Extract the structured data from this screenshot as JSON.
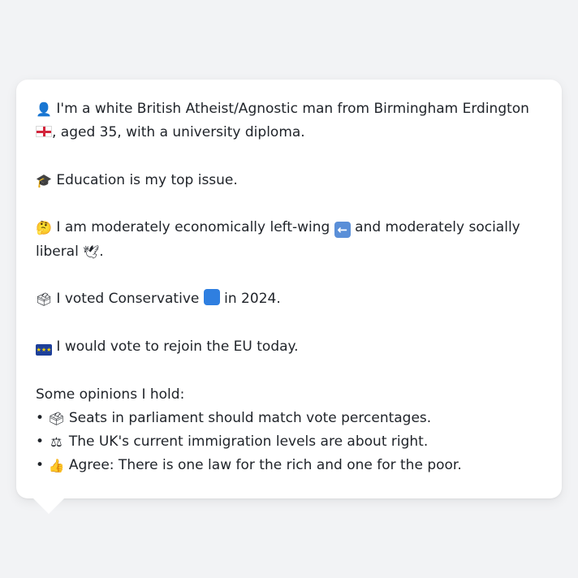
{
  "profile": {
    "intro": {
      "icon": "bust-in-silhouette-icon",
      "text_before_flag": "I'm a white British Atheist/Agnostic man from Birmingham Erdington",
      "flag": "england-flag-icon",
      "text_after_flag": ", aged 35, with a university diploma."
    },
    "top_issue": {
      "icon": "graduation-cap-icon",
      "text": "Education is my top issue."
    },
    "ideology": {
      "icon": "thinking-face-icon",
      "text_part1": "I am moderately economically left-wing",
      "left_icon": "left-arrow-icon",
      "text_part2": "and moderately socially liberal",
      "liberal_icon": "dove-icon",
      "text_end": "."
    },
    "vote_2024": {
      "icon": "ballot-box-icon",
      "text_before": "I voted Conservative",
      "party_icon": "blue-square-icon",
      "text_after": "in 2024."
    },
    "eu": {
      "icon": "eu-flag-icon",
      "text": "I would vote to rejoin the EU today."
    },
    "opinions": {
      "heading": "Some opinions I hold:",
      "bullet": "•",
      "items": [
        {
          "icon": "ballot-box-icon",
          "text": "Seats in parliament should match vote percentages."
        },
        {
          "icon": "balance-scale-icon",
          "text": "The UK's current immigration levels are about right."
        },
        {
          "icon": "thumbs-up-icon",
          "text": "Agree: There is one law for the rich and one for the poor."
        }
      ]
    }
  },
  "colors": {
    "background": "#f2f3f5",
    "card": "#ffffff",
    "text": "#1f2329",
    "england_red": "#d3243b",
    "conservative_blue": "#2f7fe0",
    "eu_blue": "#1d3f9a"
  }
}
